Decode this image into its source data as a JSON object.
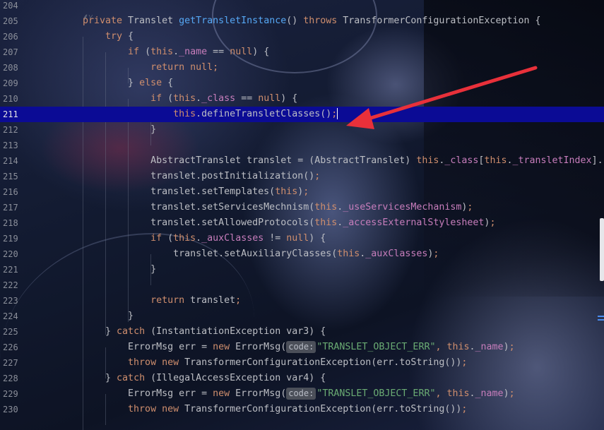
{
  "editor": {
    "fold_hint_icon": "fold-hint-icon",
    "current_line": "211",
    "lines": [
      {
        "n": "204",
        "segs": []
      },
      {
        "n": "205",
        "segs": [
          {
            "t": "private ",
            "c": "kw"
          },
          {
            "t": "Translet ",
            "c": "plain"
          },
          {
            "t": "getTransletInstance",
            "c": "fn"
          },
          {
            "t": "() ",
            "c": "plain"
          },
          {
            "t": "throws ",
            "c": "kw"
          },
          {
            "t": "TransformerConfigurationException {",
            "c": "plain"
          }
        ]
      },
      {
        "n": "206",
        "segs": [
          {
            "t": "    try ",
            "c": "kw"
          },
          {
            "t": "{",
            "c": "plain"
          }
        ]
      },
      {
        "n": "207",
        "segs": [
          {
            "t": "        if ",
            "c": "kw"
          },
          {
            "t": "(",
            "c": "plain"
          },
          {
            "t": "this",
            "c": "kw"
          },
          {
            "t": ".",
            "c": "plain"
          },
          {
            "t": "_name",
            "c": "fld"
          },
          {
            "t": " == ",
            "c": "plain"
          },
          {
            "t": "null",
            "c": "kw"
          },
          {
            "t": ") {",
            "c": "plain"
          }
        ]
      },
      {
        "n": "208",
        "segs": [
          {
            "t": "            return null",
            "c": "kw"
          },
          {
            "t": ";",
            "c": "kw"
          }
        ]
      },
      {
        "n": "209",
        "segs": [
          {
            "t": "        } ",
            "c": "plain"
          },
          {
            "t": "else ",
            "c": "kw"
          },
          {
            "t": "{",
            "c": "plain"
          }
        ]
      },
      {
        "n": "210",
        "segs": [
          {
            "t": "            if ",
            "c": "kw"
          },
          {
            "t": "(",
            "c": "plain"
          },
          {
            "t": "this",
            "c": "kw"
          },
          {
            "t": ".",
            "c": "plain"
          },
          {
            "t": "_class",
            "c": "fld"
          },
          {
            "t": " == ",
            "c": "plain"
          },
          {
            "t": "null",
            "c": "kw"
          },
          {
            "t": ") {",
            "c": "plain"
          }
        ]
      },
      {
        "n": "211",
        "segs": [
          {
            "t": "                this",
            "c": "kw"
          },
          {
            "t": ".defineTransletClasses()",
            "c": "plain"
          },
          {
            "t": ";",
            "c": "kw"
          }
        ]
      },
      {
        "n": "212",
        "segs": [
          {
            "t": "            }",
            "c": "plain"
          }
        ]
      },
      {
        "n": "213",
        "segs": []
      },
      {
        "n": "214",
        "segs": [
          {
            "t": "            AbstractTranslet translet = (AbstractTranslet) ",
            "c": "plain"
          },
          {
            "t": "this",
            "c": "kw"
          },
          {
            "t": ".",
            "c": "plain"
          },
          {
            "t": "_class",
            "c": "fld"
          },
          {
            "t": "[",
            "c": "plain"
          },
          {
            "t": "this",
            "c": "kw"
          },
          {
            "t": ".",
            "c": "plain"
          },
          {
            "t": "_transletIndex",
            "c": "fld"
          },
          {
            "t": "].",
            "c": "plain"
          }
        ]
      },
      {
        "n": "215",
        "segs": [
          {
            "t": "            translet.postInitialization()",
            "c": "plain"
          },
          {
            "t": ";",
            "c": "kw"
          }
        ]
      },
      {
        "n": "216",
        "segs": [
          {
            "t": "            translet.setTemplates(",
            "c": "plain"
          },
          {
            "t": "this",
            "c": "kw"
          },
          {
            "t": ")",
            "c": "plain"
          },
          {
            "t": ";",
            "c": "kw"
          }
        ]
      },
      {
        "n": "217",
        "segs": [
          {
            "t": "            translet.setServicesMechnism(",
            "c": "plain"
          },
          {
            "t": "this",
            "c": "kw"
          },
          {
            "t": ".",
            "c": "plain"
          },
          {
            "t": "_useServicesMechanism",
            "c": "fld"
          },
          {
            "t": ")",
            "c": "plain"
          },
          {
            "t": ";",
            "c": "kw"
          }
        ]
      },
      {
        "n": "218",
        "segs": [
          {
            "t": "            translet.setAllowedProtocols(",
            "c": "plain"
          },
          {
            "t": "this",
            "c": "kw"
          },
          {
            "t": ".",
            "c": "plain"
          },
          {
            "t": "_accessExternalStylesheet",
            "c": "fld"
          },
          {
            "t": ")",
            "c": "plain"
          },
          {
            "t": ";",
            "c": "kw"
          }
        ]
      },
      {
        "n": "219",
        "segs": [
          {
            "t": "            if ",
            "c": "kw"
          },
          {
            "t": "(",
            "c": "plain"
          },
          {
            "t": "this",
            "c": "kw"
          },
          {
            "t": ".",
            "c": "plain"
          },
          {
            "t": "_auxClasses",
            "c": "fld"
          },
          {
            "t": " != ",
            "c": "plain"
          },
          {
            "t": "null",
            "c": "kw"
          },
          {
            "t": ") {",
            "c": "plain"
          }
        ]
      },
      {
        "n": "220",
        "segs": [
          {
            "t": "                translet.setAuxiliaryClasses(",
            "c": "plain"
          },
          {
            "t": "this",
            "c": "kw"
          },
          {
            "t": ".",
            "c": "plain"
          },
          {
            "t": "_auxClasses",
            "c": "fld"
          },
          {
            "t": ")",
            "c": "plain"
          },
          {
            "t": ";",
            "c": "kw"
          }
        ]
      },
      {
        "n": "221",
        "segs": [
          {
            "t": "            }",
            "c": "plain"
          }
        ]
      },
      {
        "n": "222",
        "segs": []
      },
      {
        "n": "223",
        "segs": [
          {
            "t": "            return ",
            "c": "kw"
          },
          {
            "t": "translet",
            "c": "plain"
          },
          {
            "t": ";",
            "c": "kw"
          }
        ]
      },
      {
        "n": "224",
        "segs": [
          {
            "t": "        }",
            "c": "plain"
          }
        ]
      },
      {
        "n": "225",
        "segs": [
          {
            "t": "    } ",
            "c": "plain"
          },
          {
            "t": "catch ",
            "c": "kw"
          },
          {
            "t": "(InstantiationException var3) {",
            "c": "plain"
          }
        ]
      },
      {
        "n": "226",
        "segs": [
          {
            "t": "        ErrorMsg err = ",
            "c": "plain"
          },
          {
            "t": "new ",
            "c": "kw"
          },
          {
            "t": "ErrorMsg(",
            "c": "plain"
          },
          {
            "t": "code:",
            "c": "hint"
          },
          {
            "t": "\"TRANSLET_OBJECT_ERR\"",
            "c": "str"
          },
          {
            "t": ", ",
            "c": "kw"
          },
          {
            "t": "this",
            "c": "kw"
          },
          {
            "t": ".",
            "c": "plain"
          },
          {
            "t": "_name",
            "c": "fld"
          },
          {
            "t": ")",
            "c": "plain"
          },
          {
            "t": ";",
            "c": "kw"
          }
        ]
      },
      {
        "n": "227",
        "segs": [
          {
            "t": "        throw new ",
            "c": "kw"
          },
          {
            "t": "TransformerConfigurationException(err.toString())",
            "c": "plain"
          },
          {
            "t": ";",
            "c": "kw"
          }
        ]
      },
      {
        "n": "228",
        "segs": [
          {
            "t": "    } ",
            "c": "plain"
          },
          {
            "t": "catch ",
            "c": "kw"
          },
          {
            "t": "(IllegalAccessException var4) {",
            "c": "plain"
          }
        ]
      },
      {
        "n": "229",
        "segs": [
          {
            "t": "        ErrorMsg err = ",
            "c": "plain"
          },
          {
            "t": "new ",
            "c": "kw"
          },
          {
            "t": "ErrorMsg(",
            "c": "plain"
          },
          {
            "t": "code:",
            "c": "hint"
          },
          {
            "t": "\"TRANSLET_OBJECT_ERR\"",
            "c": "str"
          },
          {
            "t": ", ",
            "c": "kw"
          },
          {
            "t": "this",
            "c": "kw"
          },
          {
            "t": ".",
            "c": "plain"
          },
          {
            "t": "_name",
            "c": "fld"
          },
          {
            "t": ")",
            "c": "plain"
          },
          {
            "t": ";",
            "c": "kw"
          }
        ]
      },
      {
        "n": "230",
        "segs": [
          {
            "t": "        throw new ",
            "c": "kw"
          },
          {
            "t": "TransformerConfigurationException(err.toString())",
            "c": "plain"
          },
          {
            "t": ";",
            "c": "kw"
          }
        ]
      }
    ]
  },
  "annotation": {
    "type": "red-arrow",
    "color": "#e8303a",
    "target_line": "211"
  },
  "colors": {
    "keyword": "#cf8e6d",
    "method_decl": "#56a8f5",
    "field": "#c77dbb",
    "string": "#6aab73",
    "text": "#bcbec4",
    "current_line_bg": "#0b0b95"
  }
}
